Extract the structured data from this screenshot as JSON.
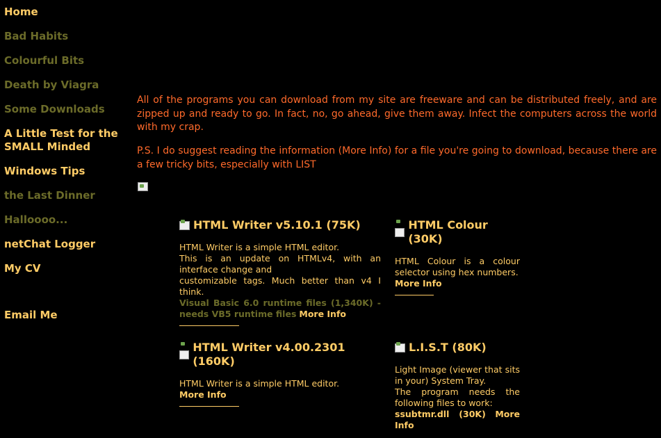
{
  "nav": {
    "home": "Home",
    "bad_habits": "Bad Habits",
    "colourful_bits": "Colourful Bits",
    "death_by_viagra": "Death by Viagra",
    "some_downloads": "Some Downloads",
    "little_test": "A Little Test for the SMALL Minded",
    "windows_tips": "Windows Tips",
    "last_dinner": "the Last Dinner",
    "halloooo": "Halloooo...",
    "netchat": "netChat Logger",
    "my_cv": "My CV",
    "email_me": "Email Me"
  },
  "intro": {
    "p1": "All of the programs you can download from my site are freeware and can be distributed freely, and are zipped up and ready to go. In fact, no, go ahead, give them away. Infect the computers across the world with my crap.",
    "p2": "P.S. I do suggest reading the information (More Info) for a file you're going to download, because there are a few tricky bits, especially with LIST"
  },
  "downloads": [
    {
      "title": "HTML Writer v5.10.1 (75K)",
      "line1": "HTML Writer is a simple HTML editor.",
      "line2": "This is an update on HTMLv4, with an interface change and",
      "line3": "customizable tags. Much better than v4 I think.",
      "runtime": "Visual Basic 6.0 runtime files (1,340K) - needs VB5 runtime files",
      "more": "More Info"
    },
    {
      "title": "HTML Colour (30K)",
      "line1": "HTML Colour is a colour selector using hex numbers.",
      "more": "More Info"
    },
    {
      "title": "HTML Writer v4.00.2301 (160K)",
      "line1": "HTML Writer is a simple HTML editor.",
      "more": "More Info"
    },
    {
      "title": "L.I.S.T (80K)",
      "line1": "Light Image (viewer that sits in your) System Tray.",
      "line2": "The program needs the following files to work:",
      "file": "ssubtmr.dll (30K)",
      "more": "More Info"
    }
  ]
}
